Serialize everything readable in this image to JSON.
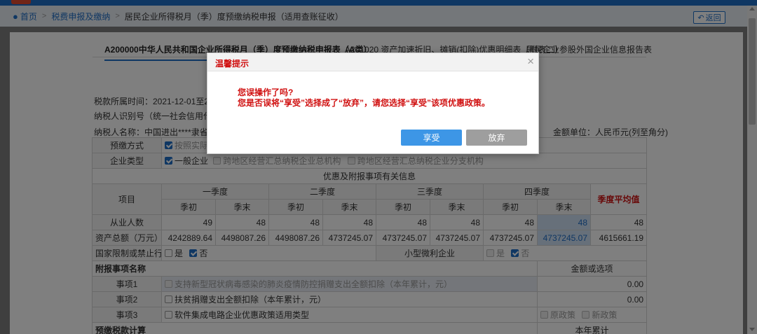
{
  "breadcrumb": {
    "home": "首页",
    "level1": "税费申报及缴纳",
    "level2": "居民企业所得税月（季）度预缴纳税申报（适用查账征收）",
    "back": "返回"
  },
  "tabs": [
    "A200000中华人民共和国企业所得税月（季）度预缴纳税申报表（A类）",
    "A201020 资产加速折旧、摊销(扣除)优惠明细表（附表二）",
    "居民企业参股外国企业信息报告表"
  ],
  "info": {
    "period": "税款所属时间：2021-12-01至2021-12",
    "taxid": "纳税人识别号（统一社会信用代码）：",
    "name": "纳税人名称：中国进出****隶省分行",
    "unit": "金额单位：人民币元(列至角分)"
  },
  "form": {
    "prepay_label": "预缴方式",
    "prepay_value": "按照实际利",
    "company_label": "企业类型",
    "company_opts": [
      "一般企业",
      "跨地区经营汇总纳税企业总机构",
      "跨地区经营汇总纳税企业分支机构"
    ],
    "section_title": "优惠及附报事项有关信息",
    "item_label": "项目",
    "quarters": [
      "一季度",
      "二季度",
      "三季度",
      "四季度"
    ],
    "begin": "季初",
    "end": "季末",
    "avg_label": "季度平均值",
    "emp_label": "从业人数",
    "emp_values": [
      "49",
      "48",
      "48",
      "48",
      "48",
      "48",
      "48",
      "48"
    ],
    "emp_avg": "48",
    "assets_label": "资产总额（万元）",
    "assets_values": [
      "4242889.64",
      "4498087.26",
      "4498087.26",
      "4737245.07",
      "4737245.07",
      "4737245.07",
      "4737245.07",
      "4737245.07"
    ],
    "assets_avg": "4615661.19",
    "restricted_label": "国家限制或禁止行业",
    "yes": "是",
    "no": "否",
    "small_label": "小型微利企业",
    "attach_title": "附报事项名称",
    "amount_title": "金额或选项",
    "items": [
      {
        "label": "事项1",
        "text": "支持新型冠状病毒感染的肺炎疫情防控捐赠支出全额扣除（本年累计，元）",
        "value": "0.00"
      },
      {
        "label": "事项2",
        "text": "扶贫捐赠支出全额扣除（本年累计，元）",
        "value": "0.00"
      },
      {
        "label": "事项3",
        "text": "软件集成电路企业优惠政策适用类型",
        "opt1": "原政策",
        "opt2": "新政策"
      }
    ],
    "bottom_left": "预缴税款计算",
    "bottom_right": "本年累计"
  },
  "dialog": {
    "title": "温馨提示",
    "line1": "您误操作了吗?",
    "line2": "您是否误将“享受”选择成了“放弃”，请您选择“享受”该项优惠政策。",
    "enjoy": "享受",
    "giveup": "放弃"
  },
  "colors": {
    "accent": "#1f6ec7",
    "warning_red": "#d01010",
    "enjoy_button": "#3d96e6",
    "giveup_button": "#9e9e9e"
  }
}
